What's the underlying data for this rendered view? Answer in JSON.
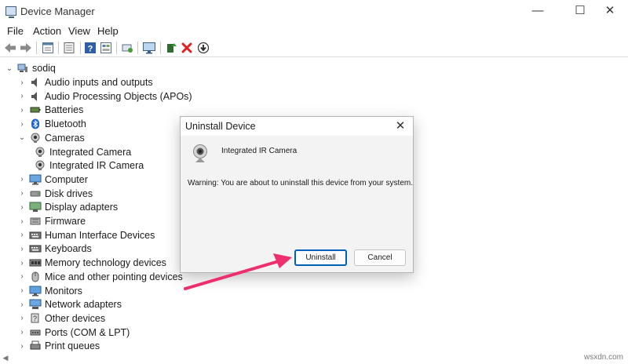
{
  "window": {
    "title": "Device Manager",
    "minimize_glyph": "—",
    "maximize_glyph": "☐",
    "close_glyph": "✕"
  },
  "menu": [
    "File",
    "Action",
    "View",
    "Help"
  ],
  "toolbar": {
    "icons": [
      "back-arrow-icon",
      "forward-arrow-icon",
      "properties-grid-icon",
      "device-list-icon",
      "help-icon",
      "resources-icon",
      "scan-hardware-icon",
      "monitor-icon",
      "update-driver-icon",
      "uninstall-x-icon",
      "disable-device-icon"
    ],
    "uninstall_color": "#e02020"
  },
  "tree": {
    "root": "sodiq",
    "items": [
      {
        "label": "Audio inputs and outputs",
        "icon": "speaker-icon",
        "expanded": false
      },
      {
        "label": "Audio Processing Objects (APOs)",
        "icon": "speaker-icon",
        "expanded": false
      },
      {
        "label": "Batteries",
        "icon": "battery-icon",
        "expanded": false
      },
      {
        "label": "Bluetooth",
        "icon": "bluetooth-icon",
        "expanded": false
      },
      {
        "label": "Cameras",
        "icon": "camera-icon",
        "expanded": true
      },
      {
        "label": "Integrated Camera",
        "icon": "camera-icon",
        "child": true
      },
      {
        "label": "Integrated IR Camera",
        "icon": "camera-icon",
        "child": true
      },
      {
        "label": "Computer",
        "icon": "computer-icon",
        "expanded": false
      },
      {
        "label": "Disk drives",
        "icon": "disk-icon",
        "expanded": false
      },
      {
        "label": "Display adapters",
        "icon": "display-icon",
        "expanded": false
      },
      {
        "label": "Firmware",
        "icon": "firmware-icon",
        "expanded": false
      },
      {
        "label": "Human Interface Devices",
        "icon": "keyboard-icon",
        "expanded": false
      },
      {
        "label": "Keyboards",
        "icon": "keyboard-icon",
        "expanded": false
      },
      {
        "label": "Memory technology devices",
        "icon": "memory-icon",
        "expanded": false
      },
      {
        "label": "Mice and other pointing devices",
        "icon": "mouse-icon",
        "expanded": false
      },
      {
        "label": "Monitors",
        "icon": "monitor-icon",
        "expanded": false
      },
      {
        "label": "Network adapters",
        "icon": "network-icon",
        "expanded": false
      },
      {
        "label": "Other devices",
        "icon": "unknown-device-icon",
        "expanded": false
      },
      {
        "label": "Ports (COM & LPT)",
        "icon": "port-icon",
        "expanded": false
      },
      {
        "label": "Print queues",
        "icon": "printer-icon",
        "expanded": false
      }
    ]
  },
  "dialog": {
    "title": "Uninstall Device",
    "device_name": "Integrated IR Camera",
    "warning": "Warning: You are about to uninstall this device from your system.",
    "uninstall_label": "Uninstall",
    "cancel_label": "Cancel",
    "close_glyph": "✕"
  },
  "colors": {
    "accent": "#005fb8",
    "arrow": "#ee2f6f"
  },
  "watermark": "wsxdn.com"
}
